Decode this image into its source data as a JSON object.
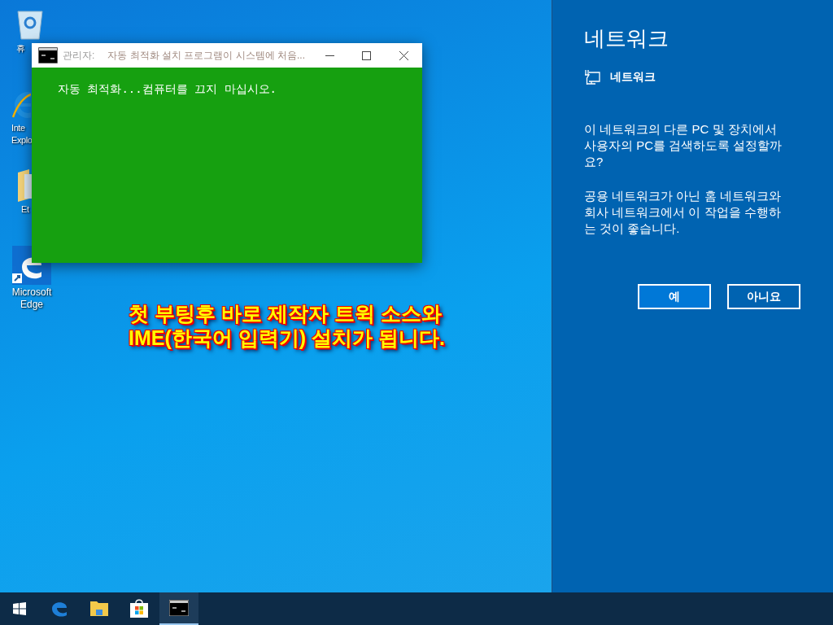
{
  "desktop_icons": [
    {
      "kind": "recycle",
      "lines": [
        "휴"
      ]
    },
    {
      "kind": "ie",
      "lines": [
        "Inte",
        "Explo"
      ]
    },
    {
      "kind": "folder",
      "lines": [
        "Et"
      ]
    },
    {
      "kind": "edge",
      "lines": [
        "Microsoft",
        "Edge"
      ]
    }
  ],
  "console_window": {
    "title_prefix": "관리자:",
    "title": "자동  최적화 설치 프로그램이 시스템에 처음...",
    "output": "자동 최적화...컴퓨터를 끄지 마십시오."
  },
  "caption": [
    "첫 부팅후 바로 제작자 트윅 소스와",
    "IME(한국어 입력기) 설치가 됩니다."
  ],
  "network_panel": {
    "title": "네트워크",
    "network_name": "네트워크",
    "question": "이 네트워크의 다른 PC 및 장치에서 사용자의 PC를 검색하도록 설정할까요?",
    "advice": "공용 네트워크가 아닌 홈 네트워크와 회사 네트워크에서 이 작업을 수행하는 것이 좋습니다.",
    "buttons": [
      {
        "label": "예",
        "selected": true
      },
      {
        "label": "아니요",
        "selected": false
      }
    ]
  },
  "taskbar": {
    "items": [
      {
        "kind": "edge",
        "selected": false
      },
      {
        "kind": "folder",
        "selected": false
      },
      {
        "kind": "store",
        "selected": false
      },
      {
        "kind": "console",
        "selected": true
      }
    ]
  }
}
